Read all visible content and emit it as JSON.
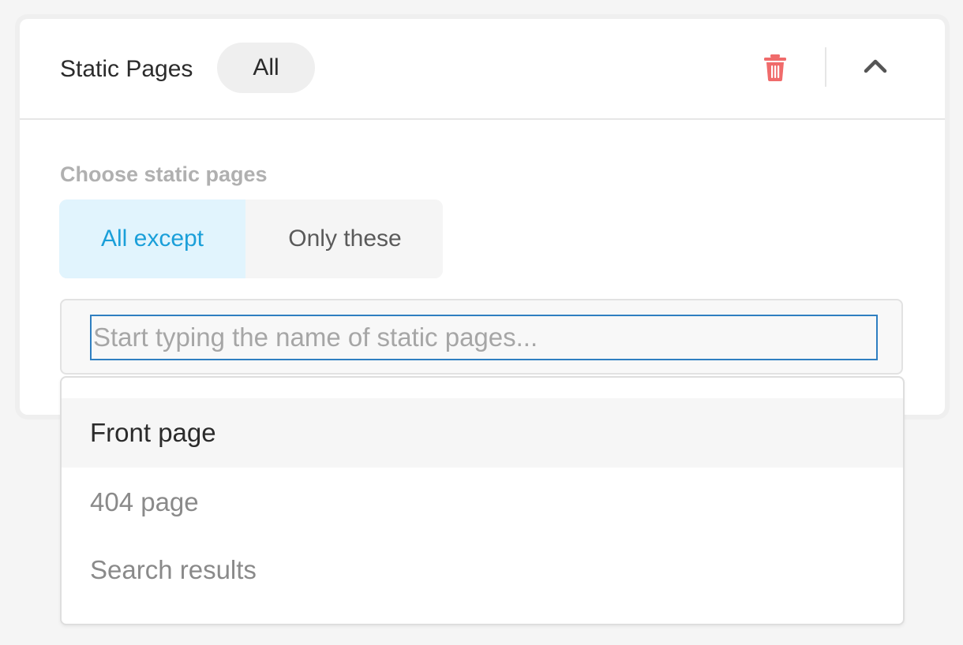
{
  "panel": {
    "title": "Static Pages",
    "scope_pill": "All"
  },
  "icons": {
    "delete": "trash-icon",
    "collapse": "chevron-up-icon"
  },
  "colors": {
    "accent": "#1a9fd9",
    "accent_bg": "#e1f4fd",
    "danger": "#f06b6b",
    "focus_border": "#2f7fc1"
  },
  "choose": {
    "label": "Choose static pages",
    "options": [
      "All except",
      "Only these"
    ],
    "selected": "All except"
  },
  "search": {
    "value": "",
    "placeholder": "Start typing the name of static pages..."
  },
  "dropdown": {
    "items": [
      "Front page",
      "404 page",
      "Search results"
    ],
    "highlighted": "Front page"
  }
}
